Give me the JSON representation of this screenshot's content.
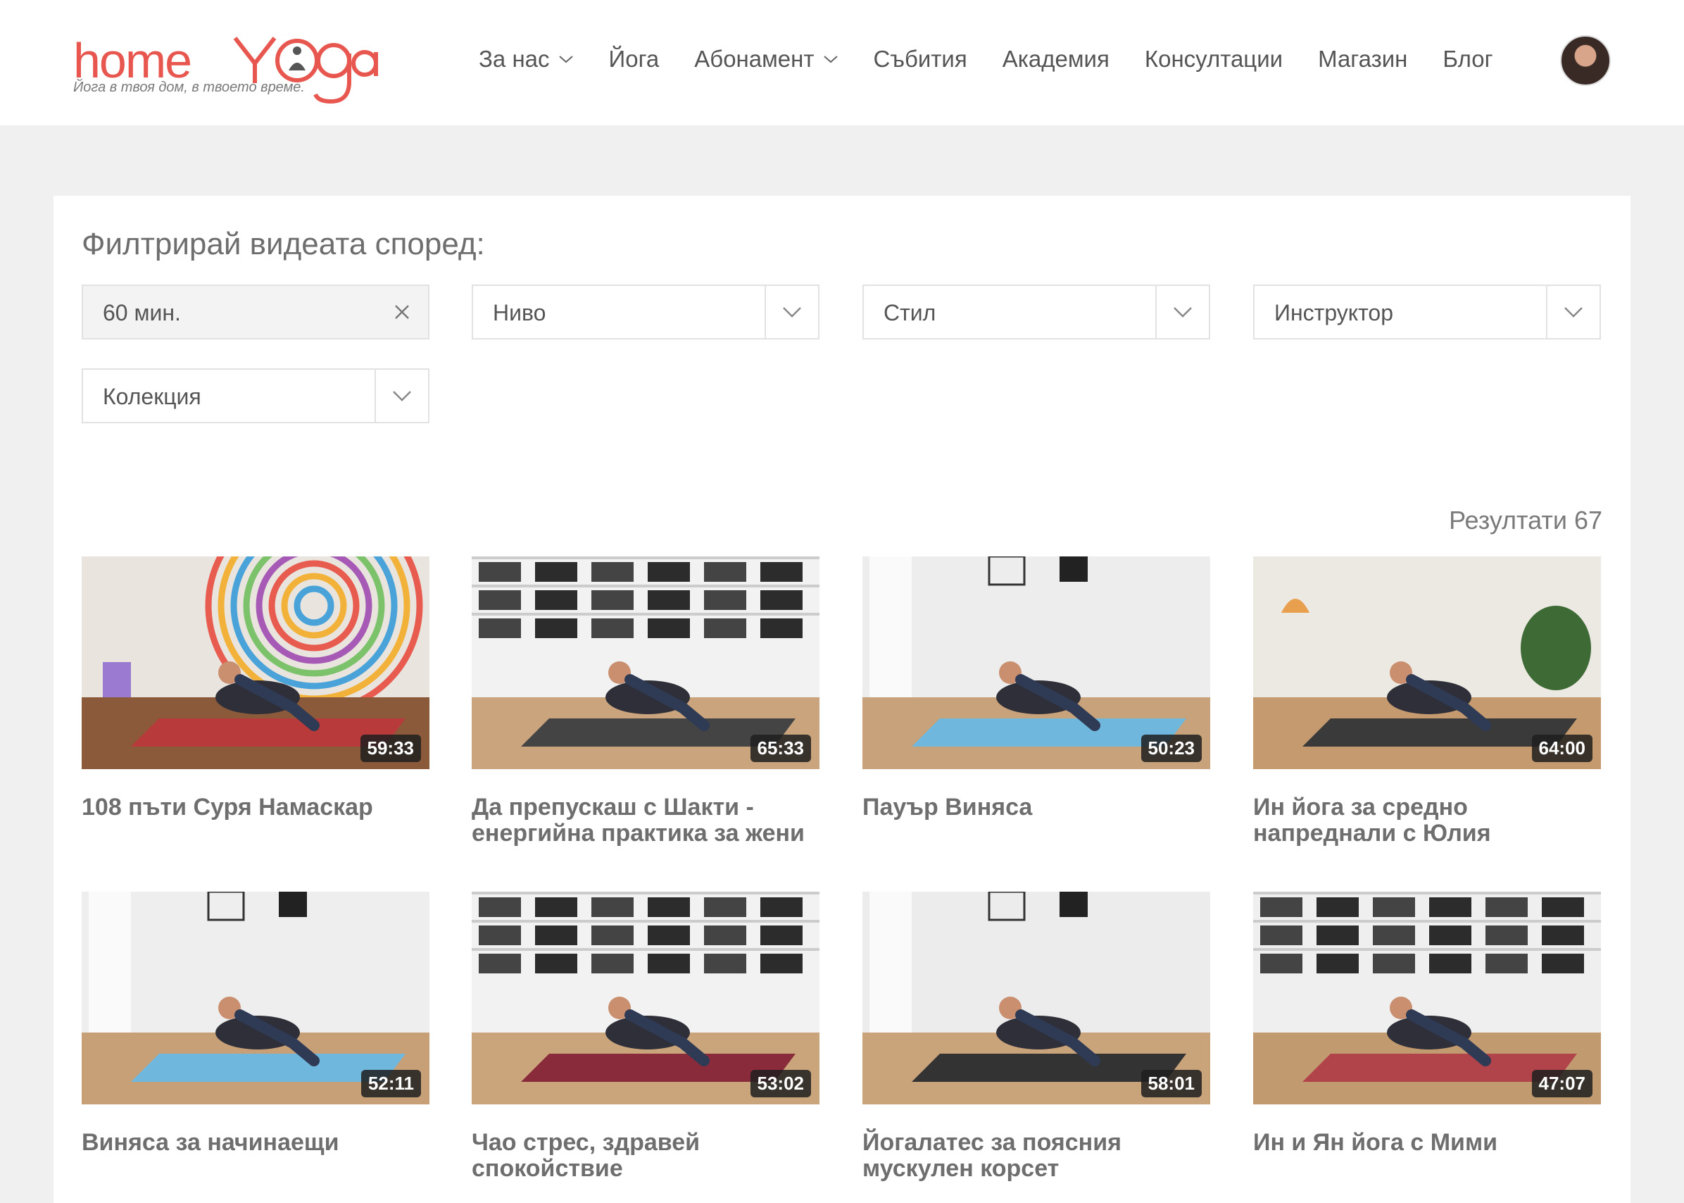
{
  "header": {
    "logo_text": "homeYoga",
    "logo_tagline": "Йога в твоя дом, в твоето време.",
    "nav": [
      {
        "label": "За нас",
        "dropdown": true
      },
      {
        "label": "Йога",
        "dropdown": false
      },
      {
        "label": "Абонамент",
        "dropdown": true
      },
      {
        "label": "Събития",
        "dropdown": false
      },
      {
        "label": "Академия",
        "dropdown": false
      },
      {
        "label": "Консултации",
        "dropdown": false
      },
      {
        "label": "Магазин",
        "dropdown": false
      },
      {
        "label": "Блог",
        "dropdown": false
      }
    ]
  },
  "filters": {
    "title": "Филтрирай видеата според:",
    "duration": "60 мин.",
    "level": "Ниво",
    "style": "Стил",
    "instructor": "Инструктор",
    "collection": "Колекция"
  },
  "results_label": "Резултати 67",
  "videos": [
    {
      "title": "108 пъти Суря Намаскар",
      "duration": "59:33"
    },
    {
      "title": "Да препускаш с Шакти - енергийна практика за жени",
      "duration": "65:33"
    },
    {
      "title": "Пауър Виняса",
      "duration": "50:23"
    },
    {
      "title": "Ин йога за средно напреднали с Юлия",
      "duration": "64:00"
    },
    {
      "title": "Виняса за начинаещи",
      "duration": "52:11"
    },
    {
      "title": "Чао стрес, здравей спокойствие",
      "duration": "53:02"
    },
    {
      "title": "Йогалатес за поясния мускулен корсет",
      "duration": "58:01"
    },
    {
      "title": "Ин и Ян йога с Мими",
      "duration": "47:07"
    }
  ],
  "colors": {
    "brand": "#e8574f",
    "text": "#6e6e6e",
    "page_bg": "#f0f0f0"
  }
}
